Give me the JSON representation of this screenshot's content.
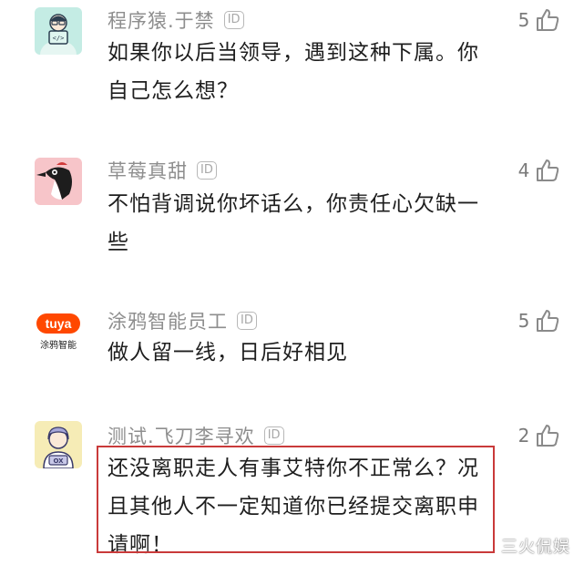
{
  "comments": [
    {
      "username": "程序猿.于禁",
      "id_badge": "ID",
      "likes": "5",
      "text_lines": [
        "如果你以后当领导，遇到这种下属。你",
        "自己怎么想？"
      ]
    },
    {
      "username": "草莓真甜",
      "id_badge": "ID",
      "likes": "4",
      "text_lines": [
        "不怕背调说你坏话么，你责任心欠缺一",
        "些"
      ]
    },
    {
      "username": "涂鸦智能员工",
      "id_badge": "ID",
      "likes": "5",
      "avatar_brand": "tuya",
      "avatar_caption": "涂鸦智能",
      "text_lines": [
        "做人留一线，日后好相见"
      ]
    },
    {
      "username": "测试.飞刀李寻欢",
      "id_badge": "ID",
      "likes": "2",
      "avatar_label": "OX",
      "text_lines": [
        "还没离职走人有事艾特你不正常么？况",
        "且其他人不一定知道你已经提交离职申",
        "请啊！"
      ]
    }
  ],
  "watermark": "三火侃娱",
  "colors": {
    "username": "#8e8e8e",
    "text": "#1e1e1e",
    "like": "#7a7a7a",
    "highlight": "#c93a3a",
    "tuya_brand": "#ff4800"
  },
  "icons": {
    "like": "thumbs-up-icon",
    "badge": "id-badge"
  }
}
